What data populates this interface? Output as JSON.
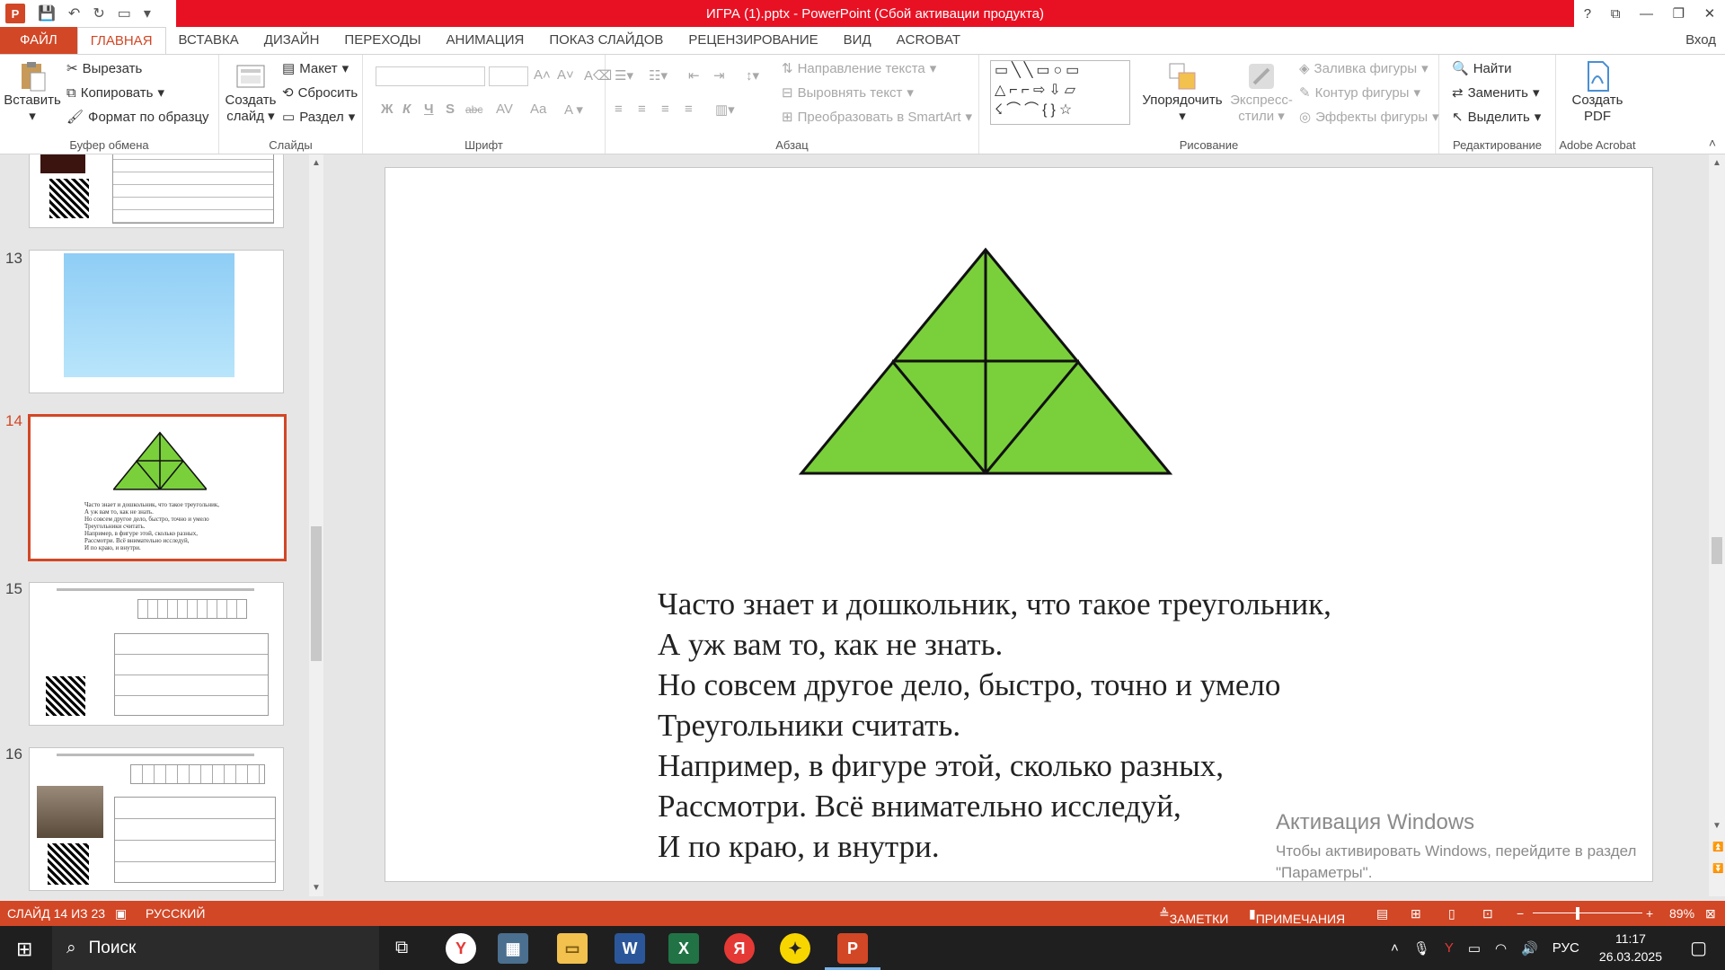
{
  "window": {
    "title": "ИГРА (1).pptx -  PowerPoint (Сбой активации продукта)",
    "controls": [
      "?",
      "⧉",
      "—",
      "❐",
      "✕"
    ]
  },
  "tabs": [
    {
      "label": "ФАЙЛ",
      "kind": "file"
    },
    {
      "label": "ГЛАВНАЯ",
      "kind": "active"
    },
    {
      "label": "ВСТАВКА"
    },
    {
      "label": "ДИЗАЙН"
    },
    {
      "label": "ПЕРЕХОДЫ"
    },
    {
      "label": "АНИМАЦИЯ"
    },
    {
      "label": "ПОКАЗ СЛАЙДОВ"
    },
    {
      "label": "РЕЦЕНЗИРОВАНИЕ"
    },
    {
      "label": "ВИД"
    },
    {
      "label": "ACROBAT"
    }
  ],
  "signin": "Вход",
  "ribbon": {
    "clipboard": {
      "label": "Буфер обмена",
      "paste": "Вставить",
      "cut": "Вырезать",
      "copy": "Копировать",
      "format_painter": "Формат по образцу"
    },
    "slides": {
      "label": "Слайды",
      "new_slide_1": "Создать",
      "new_slide_2": "слайд",
      "layout": "Макет",
      "reset": "Сбросить",
      "section": "Раздел"
    },
    "font": {
      "label": "Шрифт",
      "bold": "Ж",
      "italic": "К",
      "underline": "Ч",
      "shadow": "S",
      "strike": "abc",
      "spacing": "AV",
      "case": "Aa"
    },
    "paragraph": {
      "label": "Абзац",
      "text_direction": "Направление текста",
      "align_text": "Выровнять текст",
      "smartart": "Преобразовать в SmartArt"
    },
    "drawing": {
      "label": "Рисование",
      "arrange": "Упорядочить",
      "quick_styles_1": "Экспресс-",
      "quick_styles_2": "стили",
      "fill": "Заливка фигуры",
      "outline": "Контур фигуры",
      "effects": "Эффекты фигуры"
    },
    "editing": {
      "label": "Редактирование",
      "find": "Найти",
      "replace": "Заменить",
      "select": "Выделить"
    },
    "acrobat": {
      "label": "Adobe Acrobat",
      "create_pdf_1": "Создать",
      "create_pdf_2": "PDF"
    }
  },
  "thumbnails": {
    "numbers": [
      "13",
      "14",
      "15",
      "16"
    ],
    "slide14_text": "Часто знает и дошкольник, что такое треугольник,\nА уж вам то, как не знать.\nНо совсем другое дело, быстро, точно и умело\nТреугольники считать.\nНапример, в фигуре этой, сколько разных,\nРассмотри. Всё внимательно исследуй,\nИ по краю, и внутри."
  },
  "slide": {
    "triangle_color": "#7ad03b",
    "lines": [
      "Часто знает и дошкольник, что такое треугольник,",
      "А уж вам то, как не знать.",
      "Но совсем другое дело, быстро, точно и умело",
      "Треугольники считать.",
      "Например, в фигуре этой, сколько разных,",
      "Рассмотри. Всё внимательно исследуй,",
      "И по краю, и внутри."
    ]
  },
  "activation": {
    "title": "Активация Windows",
    "line1": "Чтобы активировать Windows, перейдите в раздел",
    "line2": "\"Параметры\"."
  },
  "statusbar": {
    "slide_info": "СЛАЙД 14 ИЗ 23",
    "language": "РУССКИЙ",
    "notes": "ЗАМЕТКИ",
    "comments": "ПРИМЕЧАНИЯ",
    "zoom": "89%"
  },
  "taskbar": {
    "search_placeholder": "Поиск",
    "lang": "РУС",
    "time": "11:17",
    "date": "26.03.2025"
  },
  "colors": {
    "accent": "#d24726",
    "title_red": "#e81123"
  }
}
